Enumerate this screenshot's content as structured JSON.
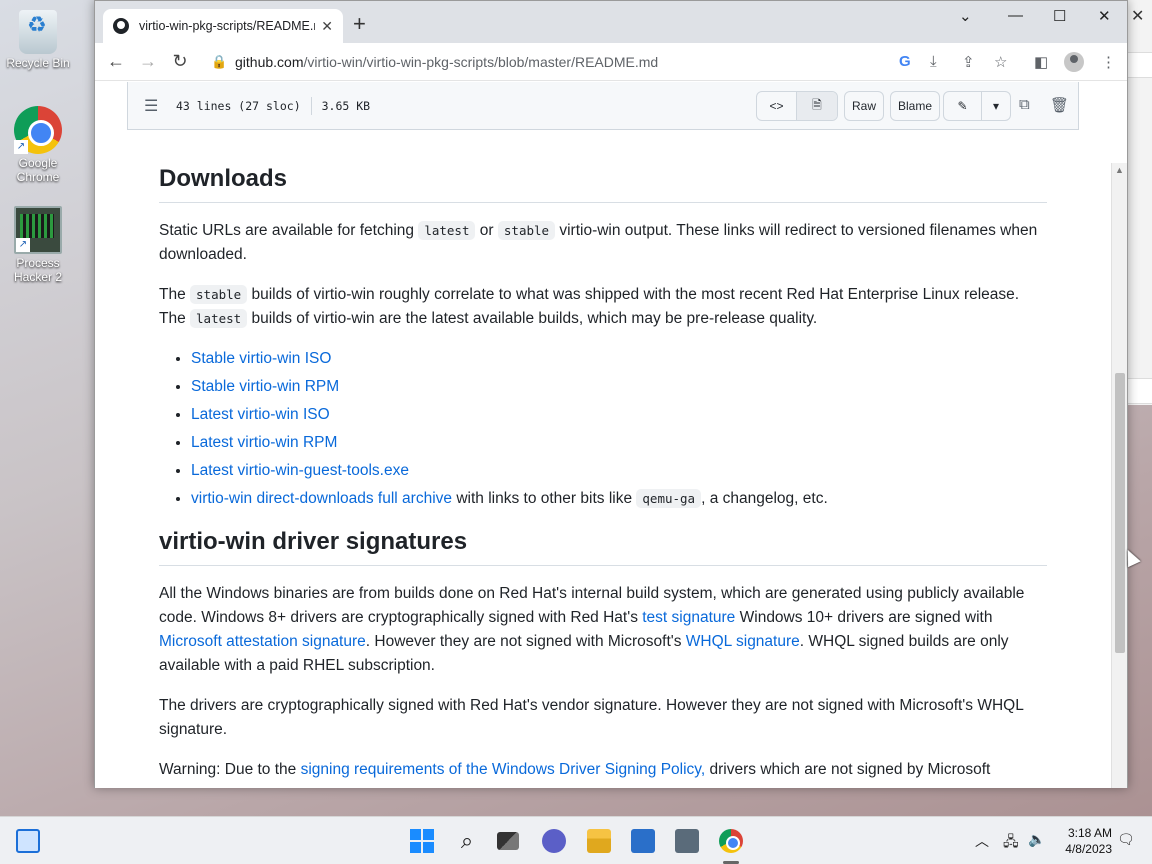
{
  "desktop": {
    "icons": [
      {
        "label": "Recycle Bin"
      },
      {
        "label": "Google Chrome"
      },
      {
        "label": "Process Hacker 2"
      }
    ]
  },
  "browser": {
    "tab_title": "virtio-win-pkg-scripts/README.m",
    "url_domain": "github.com",
    "url_path": "/virtio-win/virtio-win-pkg-scripts/blob/master/README.md"
  },
  "file_header": {
    "lines": "43 lines (27 sloc)",
    "size": "3.65 KB",
    "raw_label": "Raw",
    "blame_label": "Blame"
  },
  "readme": {
    "downloads_heading": "Downloads",
    "p1_a": "Static URLs are available for fetching ",
    "p1_code1": "latest",
    "p1_b": " or ",
    "p1_code2": "stable",
    "p1_c": " virtio-win output. These links will redirect to versioned filenames when downloaded.",
    "p2_a": "The ",
    "p2_code1": "stable",
    "p2_b": " builds of virtio-win roughly correlate to what was shipped with the most recent Red Hat Enterprise Linux release. The ",
    "p2_code2": "latest",
    "p2_c": " builds of virtio-win are the latest available builds, which may be pre-release quality.",
    "links": [
      "Stable virtio-win ISO",
      "Stable virtio-win RPM",
      "Latest virtio-win ISO",
      "Latest virtio-win RPM",
      "Latest virtio-win-guest-tools.exe"
    ],
    "archive_link": "virtio-win direct-downloads full archive",
    "archive_a": " with links to other bits like ",
    "archive_code": "qemu-ga",
    "archive_b": ", a changelog, etc.",
    "signatures_heading": "virtio-win driver signatures",
    "p3_a": "All the Windows binaries are from builds done on Red Hat's internal build system, which are generated using publicly available code. Windows 8+ drivers are cryptographically signed with Red Hat's ",
    "p3_link1": "test signature",
    "p3_b": " Windows 10+ drivers are signed with ",
    "p3_link2": "Microsoft attestation signature",
    "p3_c": ". However they are not signed with Microsoft's ",
    "p3_link3": "WHQL signature",
    "p3_d": ". WHQL signed builds are only available with a paid RHEL subscription.",
    "p4": "The drivers are cryptographically signed with Red Hat's vendor signature. However they are not signed with Microsoft's WHQL signature.",
    "p5_a": "Warning: Due to the ",
    "p5_link": "signing requirements of the Windows Driver Signing Policy,",
    "p5_b": " drivers which are not signed by Microsoft"
  },
  "taskbar": {
    "time": "3:18 AM",
    "date": "4/8/2023"
  }
}
